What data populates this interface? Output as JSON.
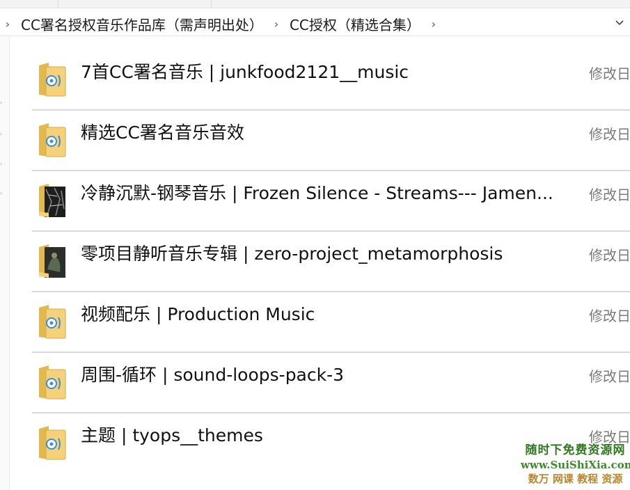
{
  "breadcrumb": {
    "items": [
      {
        "label": "CC署名授权音乐作品库（需声明出处）"
      },
      {
        "label": "CC授权（精选合集）"
      }
    ]
  },
  "column_header": "修改日",
  "folders": [
    {
      "name": "7首CC署名音乐 | junkfood2121__music",
      "icon": "folder-media-icon",
      "date": "修改日"
    },
    {
      "name": "精选CC署名音乐音效",
      "icon": "folder-media-icon",
      "date": "修改日"
    },
    {
      "name": "冷静沉默-钢琴音乐 | Frozen Silence - Streams--- Jamen...",
      "icon": "folder-album-art-icon",
      "date": "修改日"
    },
    {
      "name": "零项目静听音乐专辑 | zero-project_metamorphosis",
      "icon": "folder-album-art-icon",
      "date": "修改日"
    },
    {
      "name": "视频配乐 | Production Music",
      "icon": "folder-media-icon",
      "date": "修改日"
    },
    {
      "name": "周围-循环 | sound-loops-pack-3",
      "icon": "folder-media-icon",
      "date": "修改日"
    },
    {
      "name": "主题 | tyops__themes",
      "icon": "folder-media-icon",
      "date": "修改日"
    }
  ],
  "watermark": {
    "line1": "随时下免费资源网",
    "line2": "www.SuiShiXia.com",
    "line3": "数万 网课 教程 资源"
  },
  "colors": {
    "folder_yellow": "#f5d27a",
    "folder_dark": "#e2b94f",
    "media_blue": "#3a8fd8",
    "divider": "#d9d9d9"
  }
}
